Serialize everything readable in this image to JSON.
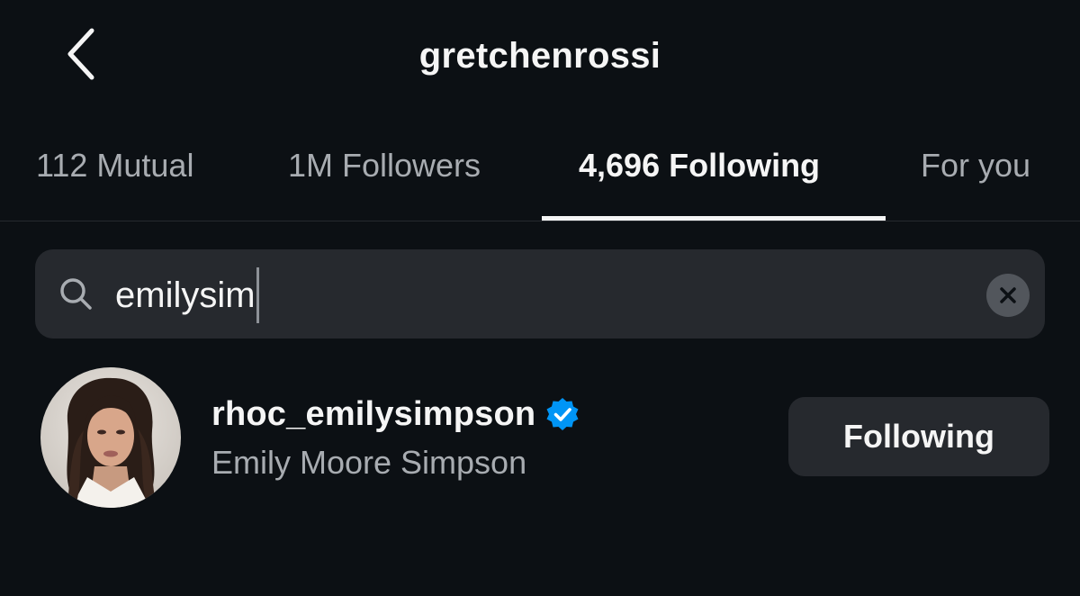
{
  "header": {
    "back_icon": "chevron-left-icon",
    "title": "gretchenrossi"
  },
  "tabs": [
    {
      "label": "112 Mutual",
      "active": false
    },
    {
      "label": "1M Followers",
      "active": false
    },
    {
      "label": "4,696 Following",
      "active": true
    },
    {
      "label": "For you",
      "active": false
    }
  ],
  "search": {
    "icon": "search-icon",
    "value": "emilysim",
    "clear_icon": "close-icon"
  },
  "results": [
    {
      "username": "rhoc_emilysimpson",
      "verified": true,
      "full_name": "Emily Moore Simpson",
      "button_label": "Following"
    }
  ],
  "colors": {
    "background": "#0c1014",
    "surface": "#26292e",
    "text_primary": "#f5f5f5",
    "text_secondary": "#a8acb1",
    "verified_blue": "#0095f6"
  }
}
